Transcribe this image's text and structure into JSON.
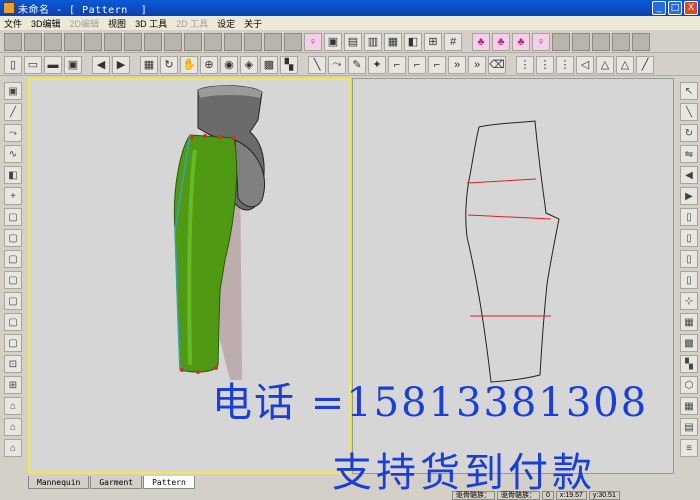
{
  "window": {
    "title": "未命名 - [ Pattern  ]",
    "min_glyph": "_",
    "max_glyph": "□",
    "close_glyph": "X"
  },
  "menu": {
    "items": [
      "文件",
      "3D编辑",
      "2D编辑",
      "视图",
      "3D 工具",
      "2D 工具",
      "设定",
      "关于"
    ],
    "disabled": [
      false,
      false,
      true,
      false,
      false,
      true,
      false,
      false
    ]
  },
  "tabs": {
    "items": [
      "Mannequin",
      "Garment",
      "Pattern"
    ],
    "active_index": 2
  },
  "status": {
    "label1": "驱骨骼族：",
    "label2": "驱骨骼族：",
    "value2": "0",
    "x_label": "x:19.57",
    "y_label": "y:30.51"
  },
  "watermark": {
    "line1": "电话 =15813381308",
    "line2": "支持货到付款"
  },
  "colors": {
    "garment": "#4f9a12",
    "pattern_line": "#222222",
    "pattern_marks": "#e02020",
    "watermark": "#1a3fd8",
    "active_view_border": "#f2e84a"
  }
}
